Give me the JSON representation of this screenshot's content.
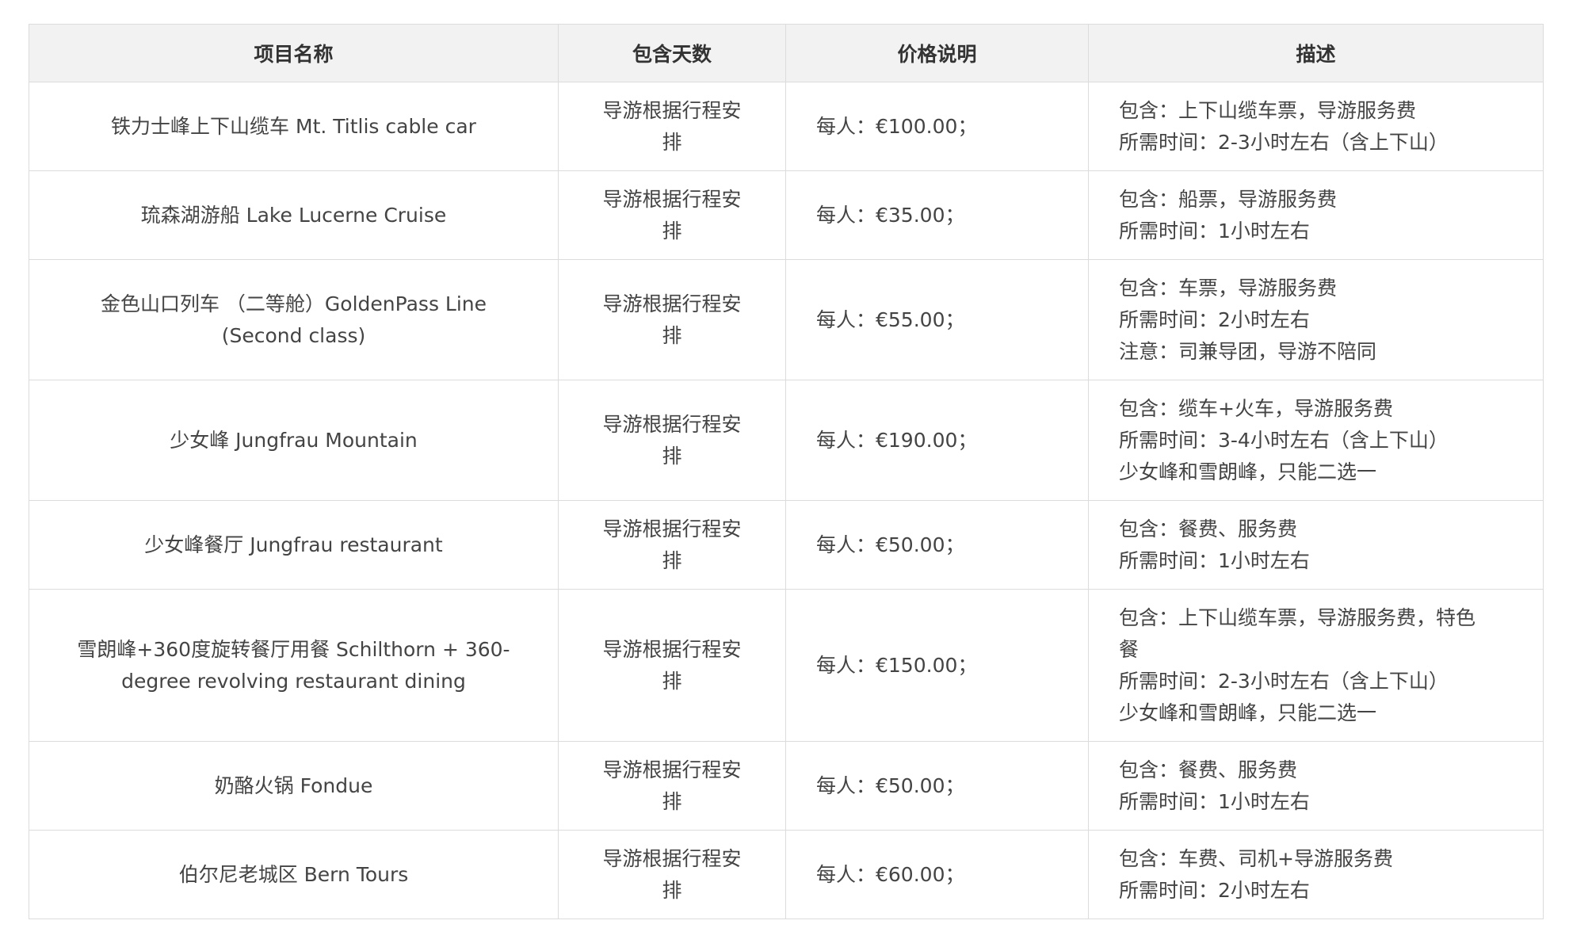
{
  "headers": [
    "项目名称",
    "包含天数",
    "价格说明",
    "描述"
  ],
  "rows": [
    {
      "name": [
        "铁力士峰上下山缆车 Mt. Titlis cable car"
      ],
      "days": [
        "导游根据行程安",
        "排"
      ],
      "price": "每人：€100.00；",
      "desc": [
        "包含：上下山缆车票，导游服务费",
        "所需时间：2-3小时左右（含上下山）"
      ]
    },
    {
      "name": [
        "琉森湖游船 Lake Lucerne Cruise"
      ],
      "days": [
        "导游根据行程安",
        "排"
      ],
      "price": "每人：€35.00；",
      "desc": [
        "包含：船票，导游服务费",
        "所需时间：1小时左右"
      ]
    },
    {
      "name": [
        "金色山口列车 （二等舱）GoldenPass Line",
        "(Second class)"
      ],
      "days": [
        "导游根据行程安",
        "排"
      ],
      "price": "每人：€55.00；",
      "desc": [
        "包含：车票，导游服务费",
        "所需时间：2小时左右",
        "注意：司兼导团，导游不陪同"
      ]
    },
    {
      "name": [
        "少女峰 Jungfrau Mountain"
      ],
      "days": [
        "导游根据行程安",
        "排"
      ],
      "price": "每人：€190.00；",
      "desc": [
        "包含：缆车+火车，导游服务费",
        "所需时间：3-4小时左右（含上下山）",
        "少女峰和雪朗峰，只能二选一"
      ]
    },
    {
      "name": [
        "少女峰餐厅 Jungfrau restaurant"
      ],
      "days": [
        "导游根据行程安",
        "排"
      ],
      "price": "每人：€50.00；",
      "desc": [
        "包含：餐费、服务费",
        "所需时间：1小时左右"
      ]
    },
    {
      "name": [
        "雪朗峰+360度旋转餐厅用餐 Schilthorn + 360-",
        "degree revolving restaurant dining"
      ],
      "days": [
        "导游根据行程安",
        "排"
      ],
      "price": "每人：€150.00；",
      "desc": [
        "包含：上下山缆车票，导游服务费，特色",
        "餐",
        "所需时间：2-3小时左右（含上下山）",
        "少女峰和雪朗峰，只能二选一"
      ]
    },
    {
      "name": [
        "奶酪火锅 Fondue"
      ],
      "days": [
        "导游根据行程安",
        "排"
      ],
      "price": "每人：€50.00；",
      "desc": [
        "包含：餐费、服务费",
        "所需时间：1小时左右"
      ]
    },
    {
      "name": [
        "伯尔尼老城区 Bern Tours"
      ],
      "days": [
        "导游根据行程安",
        "排"
      ],
      "price": "每人：€60.00；",
      "desc": [
        "包含：车费、司机+导游服务费",
        "所需时间：2小时左右"
      ]
    }
  ]
}
